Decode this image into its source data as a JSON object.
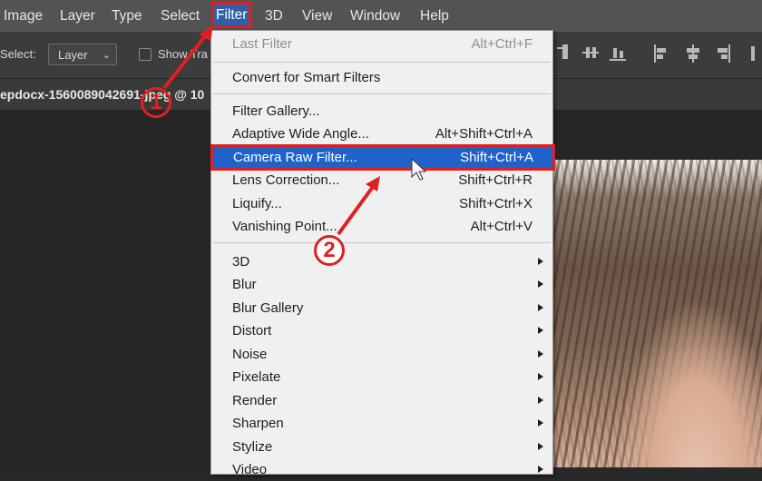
{
  "menubar": {
    "items": [
      "Image",
      "Layer",
      "Type",
      "Select",
      "Filter",
      "3D",
      "View",
      "Window",
      "Help"
    ],
    "active": "Filter"
  },
  "options_bar": {
    "select_label": "Select:",
    "select_value": "Layer",
    "show_label": "Show Tra"
  },
  "document": {
    "tab_title": "epdocx-1560089042691-jpeg @ 10"
  },
  "filter_menu": {
    "items": [
      {
        "label": "Last Filter",
        "shortcut": "Alt+Ctrl+F",
        "disabled": true
      },
      {
        "label": "Convert for Smart Filters",
        "shortcut": ""
      },
      {
        "label": "Filter Gallery...",
        "shortcut": ""
      },
      {
        "label": "Adaptive Wide Angle...",
        "shortcut": "Alt+Shift+Ctrl+A"
      },
      {
        "label": "Camera Raw Filter...",
        "shortcut": "Shift+Ctrl+A",
        "highlighted": true
      },
      {
        "label": "Lens Correction...",
        "shortcut": "Shift+Ctrl+R"
      },
      {
        "label": "Liquify...",
        "shortcut": "Shift+Ctrl+X"
      },
      {
        "label": "Vanishing Point...",
        "shortcut": "Alt+Ctrl+V"
      },
      {
        "label": "3D",
        "submenu": true
      },
      {
        "label": "Blur",
        "submenu": true
      },
      {
        "label": "Blur Gallery",
        "submenu": true
      },
      {
        "label": "Distort",
        "submenu": true
      },
      {
        "label": "Noise",
        "submenu": true
      },
      {
        "label": "Pixelate",
        "submenu": true
      },
      {
        "label": "Render",
        "submenu": true
      },
      {
        "label": "Sharpen",
        "submenu": true
      },
      {
        "label": "Stylize",
        "submenu": true
      },
      {
        "label": "Video",
        "submenu": true
      }
    ]
  },
  "annotations": {
    "step1": "1",
    "step2": "2",
    "color": "#e02020"
  },
  "colors": {
    "menubar_bg": "#535353",
    "menu_bg": "#f0f0f0",
    "highlight_bg": "#1f62c9",
    "annotation_red": "#e02020"
  }
}
